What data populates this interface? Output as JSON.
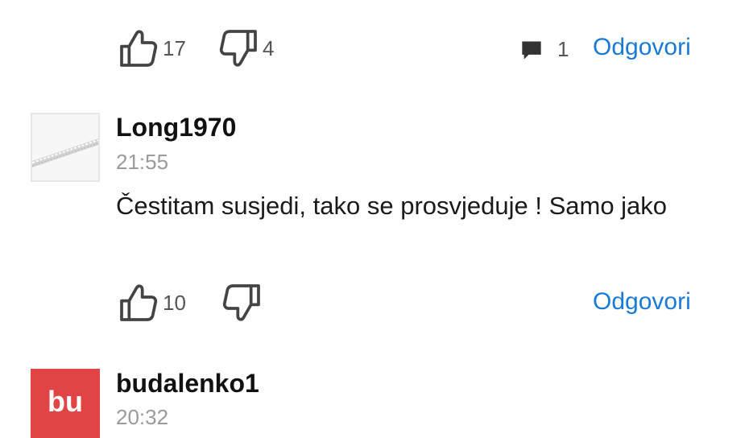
{
  "comments": [
    {
      "likes": "17",
      "dislikes": "4",
      "reply_count": "1",
      "reply_label": "Odgovori"
    },
    {
      "username": "Long1970",
      "time": "21:55",
      "text": "Čestitam susjedi, tako se prosvjeduje ! Samo jako",
      "likes": "10",
      "dislikes": "",
      "reply_label": "Odgovori"
    },
    {
      "avatar_initials": "bu",
      "avatar_color": "#e04444",
      "username": "budalenko1",
      "time": "20:32"
    }
  ],
  "colors": {
    "link": "#1a7bd6",
    "muted": "#9a9a9a",
    "icon": "#555555"
  },
  "icons": [
    "thumbs-up-icon",
    "thumbs-down-icon",
    "comment-bubble-icon"
  ]
}
